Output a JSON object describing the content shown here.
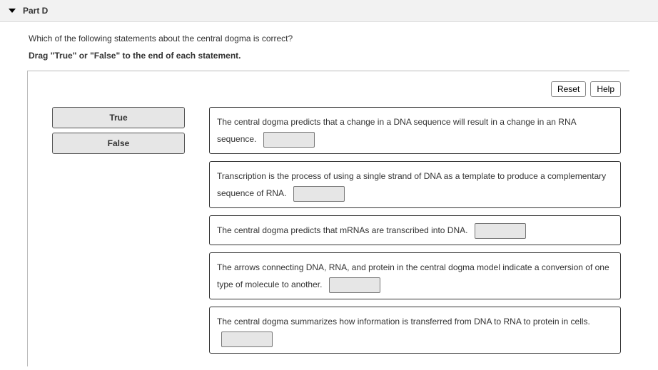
{
  "header": {
    "part_label": "Part D"
  },
  "question": {
    "prompt": "Which of the following statements about the central dogma is correct?",
    "instruction": "Drag \"True\" or \"False\" to the end of each statement."
  },
  "toolbar": {
    "reset_label": "Reset",
    "help_label": "Help"
  },
  "bins": {
    "true_label": "True",
    "false_label": "False"
  },
  "statements": [
    "The central dogma predicts that a change in a DNA sequence will result in a change in an RNA sequence.",
    "Transcription is the process of using a single strand of DNA as a template to produce a complementary sequence of RNA.",
    "The central dogma predicts that mRNAs are transcribed into DNA.",
    "The arrows connecting DNA, RNA, and protein in the central dogma model indicate a conversion of one type of molecule to another.",
    "The central dogma summarizes how information is transferred from DNA to RNA to protein in cells."
  ]
}
